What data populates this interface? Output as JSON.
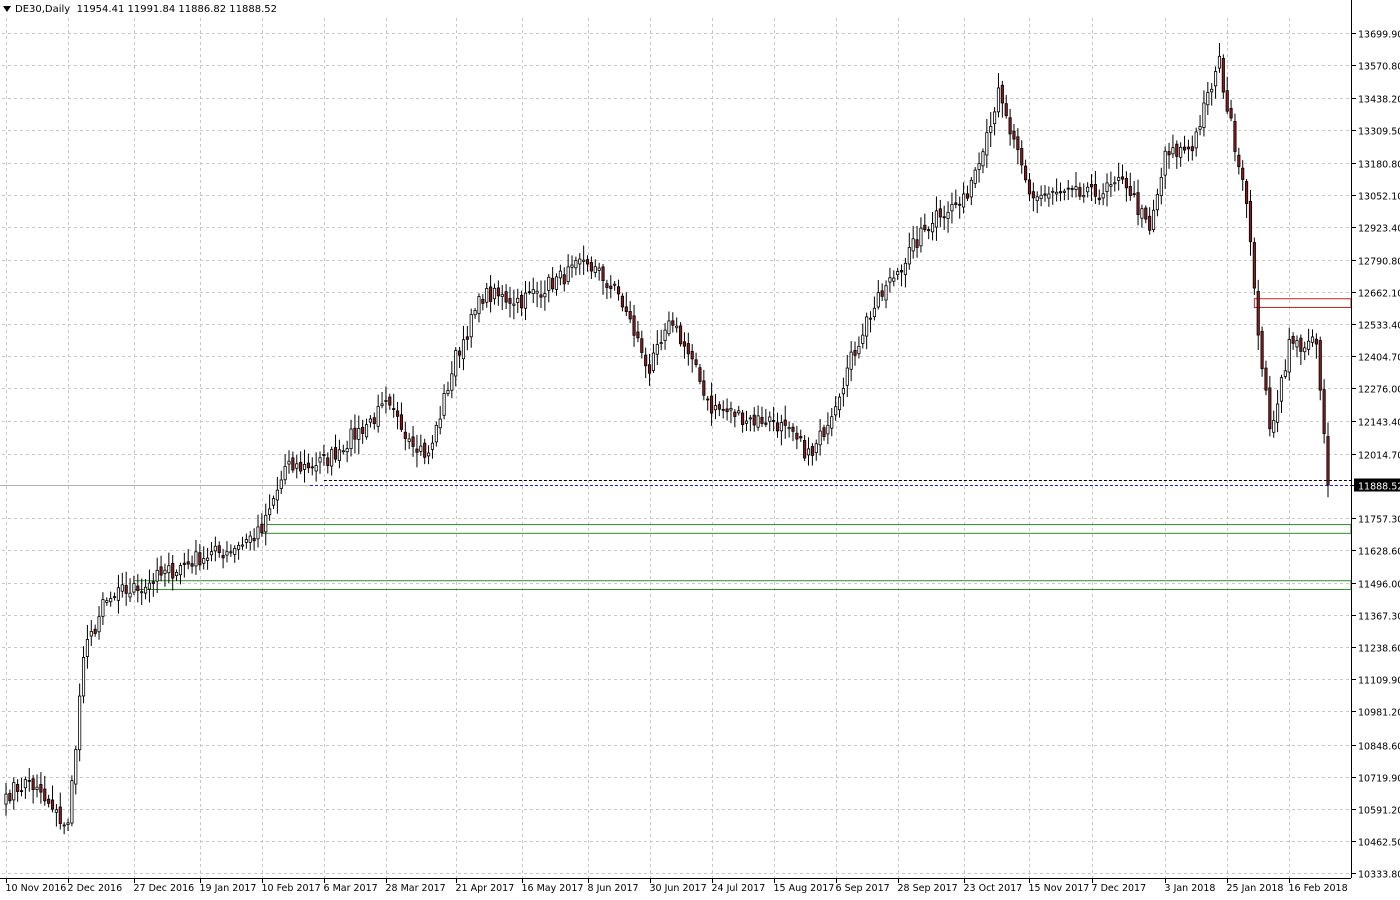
{
  "header": {
    "symbol": "DE30,Daily",
    "ohlc": "11954.41 11991.84 11886.82 11888.52"
  },
  "colors": {
    "bull_body": "#ffffff",
    "bear_body": "#8b1a1a",
    "candle_outline": "#000000",
    "grid": "#c8c8c8",
    "support_zone": "#2e8b2e",
    "resistance_zone": "#d02020",
    "price_line": "#1a1aff",
    "price_label_bg": "#000000",
    "price_label_fg": "#ffffff"
  },
  "chart_data": {
    "type": "candlestick",
    "title": "DE30,Daily",
    "ylim": [
      10333.8,
      13760
    ],
    "y_ticks": [
      "13699.90",
      "13570.80",
      "13438.20",
      "13309.50",
      "13180.80",
      "13052.10",
      "12923.40",
      "12790.80",
      "12662.10",
      "12533.40",
      "12404.70",
      "12276.00",
      "12143.40",
      "12014.70",
      "11888.52",
      "11757.30",
      "11628.60",
      "11496.00",
      "11367.30",
      "11238.60",
      "11109.90",
      "10981.20",
      "10848.60",
      "10719.90",
      "10591.20",
      "10462.50",
      "10333.80"
    ],
    "x_ticks": [
      "10 Nov 2016",
      "2 Dec 2016",
      "27 Dec 2016",
      "19 Jan 2017",
      "10 Feb 2017",
      "6 Mar 2017",
      "28 Mar 2017",
      "21 Apr 2017",
      "16 May 2017",
      "8 Jun 2017",
      "30 Jun 2017",
      "24 Jul 2017",
      "15 Aug 2017",
      "6 Sep 2017",
      "28 Sep 2017",
      "23 Oct 2017",
      "15 Nov 2017",
      "7 Dec 2017",
      "3 Jan 2018",
      "25 Jan 2018",
      "16 Feb 2018"
    ],
    "last_price": "11888.52",
    "anchors": [
      {
        "date": "10 Nov 2016",
        "close": 10650
      },
      {
        "date": "18 Nov 2016",
        "close": 10700
      },
      {
        "date": "28 Nov 2016",
        "close": 10580
      },
      {
        "date": "2 Dec 2016",
        "close": 10520
      },
      {
        "date": "8 Dec 2016",
        "close": 11200
      },
      {
        "date": "15 Dec 2016",
        "close": 11400
      },
      {
        "date": "22 Dec 2016",
        "close": 11460
      },
      {
        "date": "27 Dec 2016",
        "close": 11470
      },
      {
        "date": "19 Jan 2017",
        "close": 11600
      },
      {
        "date": "27 Jan 2017",
        "close": 11620
      },
      {
        "date": "10 Feb 2017",
        "close": 11700
      },
      {
        "date": "20 Feb 2017",
        "close": 11950
      },
      {
        "date": "6 Mar 2017",
        "close": 11980
      },
      {
        "date": "20 Mar 2017",
        "close": 12120
      },
      {
        "date": "28 Mar 2017",
        "close": 12200
      },
      {
        "date": "12 Apr 2017",
        "close": 12000
      },
      {
        "date": "21 Apr 2017",
        "close": 12400
      },
      {
        "date": "2 May 2017",
        "close": 12650
      },
      {
        "date": "16 May 2017",
        "close": 12630
      },
      {
        "date": "8 Jun 2017",
        "close": 12780
      },
      {
        "date": "20 Jun 2017",
        "close": 12650
      },
      {
        "date": "30 Jun 2017",
        "close": 12350
      },
      {
        "date": "10 Jul 2017",
        "close": 12550
      },
      {
        "date": "24 Jul 2017",
        "close": 12200
      },
      {
        "date": "8 Aug 2017",
        "close": 12150
      },
      {
        "date": "15 Aug 2017",
        "close": 12150
      },
      {
        "date": "29 Aug 2017",
        "close": 12000
      },
      {
        "date": "6 Sep 2017",
        "close": 12230
      },
      {
        "date": "18 Sep 2017",
        "close": 12550
      },
      {
        "date": "28 Sep 2017",
        "close": 12750
      },
      {
        "date": "12 Oct 2017",
        "close": 12980
      },
      {
        "date": "23 Oct 2017",
        "close": 13020
      },
      {
        "date": "3 Nov 2017",
        "close": 13450
      },
      {
        "date": "15 Nov 2017",
        "close": 13050
      },
      {
        "date": "27 Nov 2017",
        "close": 13050
      },
      {
        "date": "7 Dec 2017",
        "close": 13050
      },
      {
        "date": "20 Dec 2017",
        "close": 13100
      },
      {
        "date": "28 Dec 2017",
        "close": 12900
      },
      {
        "date": "3 Jan 2018",
        "close": 13200
      },
      {
        "date": "12 Jan 2018",
        "close": 13250
      },
      {
        "date": "23 Jan 2018",
        "close": 13580
      },
      {
        "date": "25 Jan 2018",
        "close": 13400
      },
      {
        "date": "1 Feb 2018",
        "close": 13050
      },
      {
        "date": "5 Feb 2018",
        "close": 12650
      },
      {
        "date": "9 Feb 2018",
        "close": 12100
      },
      {
        "date": "16 Feb 2018",
        "close": 12450
      },
      {
        "date": "21 Feb 2018",
        "close": 12450
      },
      {
        "date": "27 Feb 2018",
        "close": 12450
      },
      {
        "date": "2 Mar 2018",
        "close": 11888.52
      }
    ],
    "levels": [
      {
        "type": "support_zone",
        "from_date": "10 Feb 2017",
        "y_low": 11695,
        "y_high": 11730
      },
      {
        "type": "support_zone",
        "from_date": "27 Dec 2016",
        "y_low": 11470,
        "y_high": 11505
      },
      {
        "type": "resistance_zone",
        "from_date": "5 Feb 2018",
        "y_low": 12600,
        "y_high": 12635
      },
      {
        "type": "dashed_line",
        "from_date": "6 Mar 2017",
        "y": 11910
      }
    ]
  }
}
